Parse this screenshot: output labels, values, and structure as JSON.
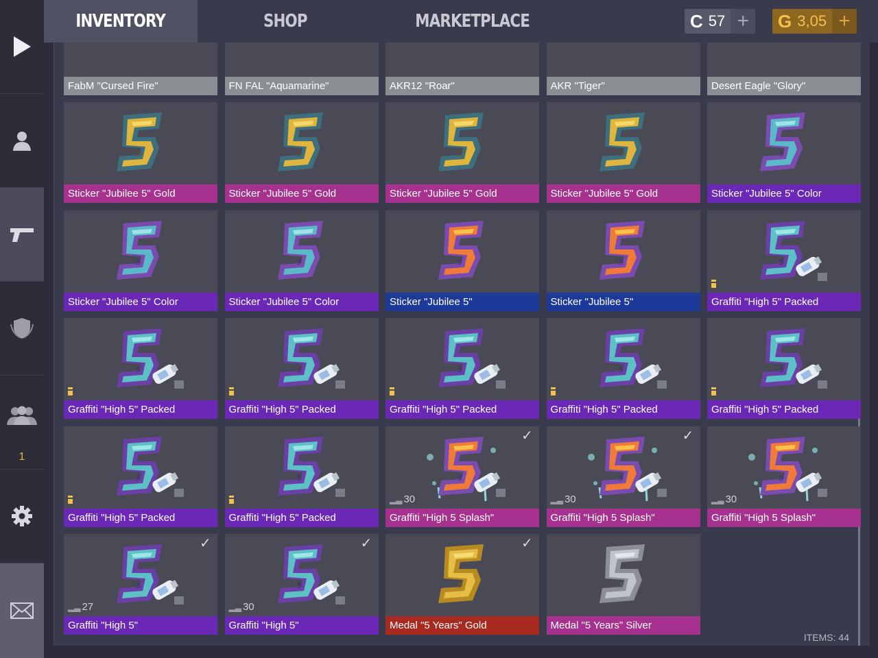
{
  "sidebar": {
    "items": [
      {
        "name": "play",
        "icon": "play-icon"
      },
      {
        "name": "profile",
        "icon": "user-icon"
      },
      {
        "name": "inventory",
        "icon": "pistol-icon",
        "active": true
      },
      {
        "name": "clan",
        "icon": "shield-icon"
      },
      {
        "name": "friends",
        "icon": "friends-icon",
        "count": "1"
      },
      {
        "name": "settings",
        "icon": "gear-icon"
      },
      {
        "name": "mail",
        "icon": "mail-icon"
      }
    ]
  },
  "header": {
    "tabs": [
      {
        "label": "INVENTORY",
        "active": true
      },
      {
        "label": "SHOP",
        "active": false
      },
      {
        "label": "MARKETPLACE",
        "active": false
      }
    ],
    "credits": {
      "icon": "C",
      "value": "57",
      "plus": "+"
    },
    "gold": {
      "icon": "G",
      "value": "3,05",
      "plus": "+"
    }
  },
  "items": [
    {
      "name": "FabM \"Cursed Fire\"",
      "rarity": "grey",
      "art": "weapon"
    },
    {
      "name": "FN FAL \"Aquamarine\"",
      "rarity": "grey",
      "art": "weapon"
    },
    {
      "name": "AKR12 \"Roar\"",
      "rarity": "grey",
      "art": "weapon"
    },
    {
      "name": "AKR \"Tiger\"",
      "rarity": "grey",
      "art": "weapon"
    },
    {
      "name": "Desert Eagle \"Glory\"",
      "rarity": "grey",
      "art": "weapon"
    },
    {
      "name": "Sticker \"Jubilee 5\" Gold",
      "rarity": "pink",
      "art": "gold"
    },
    {
      "name": "Sticker \"Jubilee 5\" Gold",
      "rarity": "pink",
      "art": "gold"
    },
    {
      "name": "Sticker \"Jubilee 5\" Gold",
      "rarity": "pink",
      "art": "gold"
    },
    {
      "name": "Sticker \"Jubilee 5\" Gold",
      "rarity": "pink",
      "art": "gold"
    },
    {
      "name": "Sticker \"Jubilee 5\" Color",
      "rarity": "purple",
      "art": "color"
    },
    {
      "name": "Sticker \"Jubilee 5\" Color",
      "rarity": "purple",
      "art": "color"
    },
    {
      "name": "Sticker \"Jubilee 5\" Color",
      "rarity": "purple",
      "art": "color"
    },
    {
      "name": "Sticker \"Jubilee 5\"",
      "rarity": "blue",
      "art": "orange"
    },
    {
      "name": "Sticker \"Jubilee 5\"",
      "rarity": "blue",
      "art": "orange"
    },
    {
      "name": "Graffiti \"High 5\" Packed",
      "rarity": "purple",
      "art": "graffiti",
      "packed": true
    },
    {
      "name": "Graffiti \"High 5\" Packed",
      "rarity": "purple",
      "art": "graffiti",
      "packed": true
    },
    {
      "name": "Graffiti \"High 5\" Packed",
      "rarity": "purple",
      "art": "graffiti",
      "packed": true
    },
    {
      "name": "Graffiti \"High 5\" Packed",
      "rarity": "purple",
      "art": "graffiti",
      "packed": true
    },
    {
      "name": "Graffiti \"High 5\" Packed",
      "rarity": "purple",
      "art": "graffiti",
      "packed": true
    },
    {
      "name": "Graffiti \"High 5\" Packed",
      "rarity": "purple",
      "art": "graffiti",
      "packed": true
    },
    {
      "name": "Graffiti \"High 5\" Packed",
      "rarity": "purple",
      "art": "graffiti",
      "packed": true
    },
    {
      "name": "Graffiti \"High 5\" Packed",
      "rarity": "purple",
      "art": "graffiti",
      "packed": true
    },
    {
      "name": "Graffiti \"High 5 Splash\"",
      "rarity": "pink",
      "art": "splash",
      "count": "30",
      "checked": true
    },
    {
      "name": "Graffiti \"High 5 Splash\"",
      "rarity": "pink",
      "art": "splash",
      "count": "30",
      "checked": true
    },
    {
      "name": "Graffiti \"High 5 Splash\"",
      "rarity": "pink",
      "art": "splash",
      "count": "30"
    },
    {
      "name": "Graffiti \"High 5\"",
      "rarity": "purple",
      "art": "graffiti",
      "count": "27",
      "checked": true
    },
    {
      "name": "Graffiti \"High 5\"",
      "rarity": "purple",
      "art": "graffiti",
      "count": "30",
      "checked": true
    },
    {
      "name": "Medal \"5 Years\" Gold",
      "rarity": "red",
      "art": "medal-gold",
      "checked": true
    },
    {
      "name": "Medal \"5 Years\" Silver",
      "rarity": "pink",
      "art": "medal-silver"
    }
  ],
  "footer": {
    "items_count": "ITEMS: 44"
  },
  "colors": {
    "rarity_grey": "#8b8f94",
    "rarity_pink": "#a6318e",
    "rarity_purple": "#6b27b5",
    "rarity_blue": "#1d3a9a",
    "rarity_red": "#a8291f",
    "gold_accent": "#e9b53a"
  }
}
